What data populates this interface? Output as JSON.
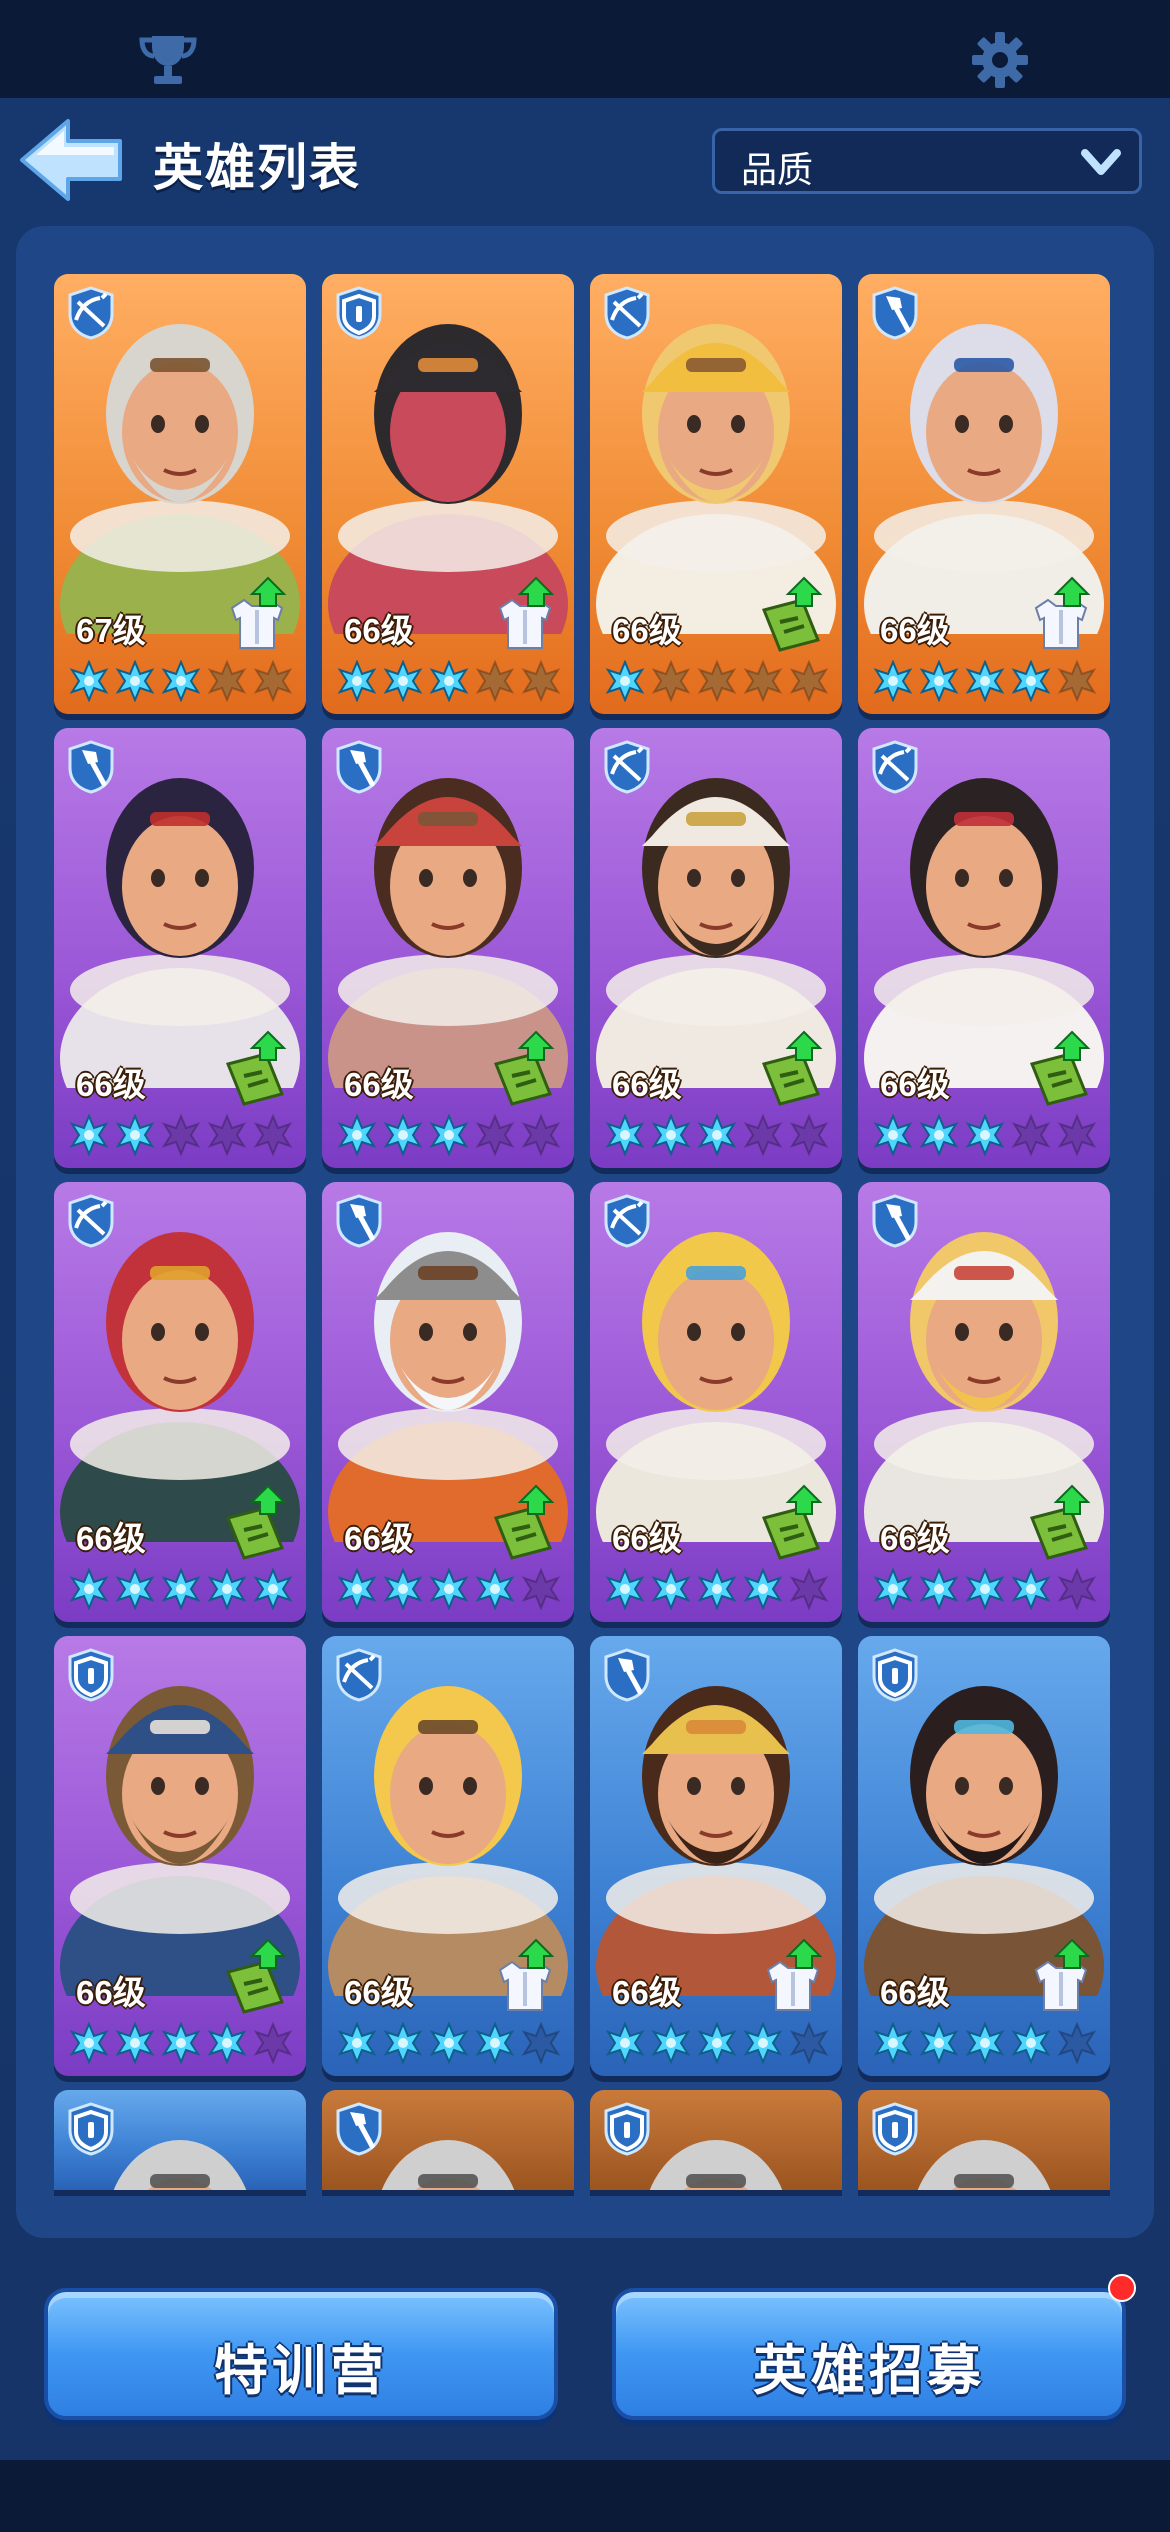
{
  "topbar": {
    "left_icon": "trophy-icon",
    "right_icon": "gear-icon"
  },
  "header": {
    "title": "英雄列表",
    "filter": {
      "selected": "品质"
    }
  },
  "colors": {
    "star_filled": "#4fd6ff",
    "star_empty": "#8f5a2a",
    "accent": "#3f97f2",
    "notify": "#ff2a2a"
  },
  "heroes": [
    {
      "level_label": "67级",
      "stars": 3,
      "rarity": "orange",
      "role_icon": "crossbow-icon",
      "upgrade_icon": "armor-upgrade-icon",
      "look": "old-bearded-ranger"
    },
    {
      "level_label": "66级",
      "stars": 3,
      "rarity": "orange",
      "role_icon": "shield-icon",
      "upgrade_icon": "armor-upgrade-icon",
      "look": "helmet-welder"
    },
    {
      "level_label": "66级",
      "stars": 1,
      "rarity": "orange",
      "role_icon": "crossbow-icon",
      "upgrade_icon": "manual-upgrade-icon",
      "look": "miner-helmet"
    },
    {
      "level_label": "66级",
      "stars": 4,
      "rarity": "orange",
      "role_icon": "shovel-icon",
      "upgrade_icon": "armor-upgrade-icon",
      "look": "goggles-girl"
    },
    {
      "level_label": "66级",
      "stars": 2,
      "rarity": "purple",
      "role_icon": "shovel-icon",
      "upgrade_icon": "manual-upgrade-icon",
      "look": "ponytail-warrior"
    },
    {
      "level_label": "66级",
      "stars": 3,
      "rarity": "purple",
      "role_icon": "shovel-icon",
      "upgrade_icon": "manual-upgrade-icon",
      "look": "headband-man"
    },
    {
      "level_label": "66级",
      "stars": 3,
      "rarity": "purple",
      "role_icon": "crossbow-icon",
      "upgrade_icon": "manual-upgrade-icon",
      "look": "desert-hood"
    },
    {
      "level_label": "66级",
      "stars": 3,
      "rarity": "purple",
      "role_icon": "crossbow-icon",
      "upgrade_icon": "manual-upgrade-icon",
      "look": "nurse-girl"
    },
    {
      "level_label": "66级",
      "stars": 5,
      "rarity": "purple",
      "role_icon": "crossbow-icon",
      "upgrade_icon": "manual-upgrade-icon",
      "look": "red-hair-woman"
    },
    {
      "level_label": "66级",
      "stars": 4,
      "rarity": "purple",
      "role_icon": "shovel-icon",
      "upgrade_icon": "manual-upgrade-icon",
      "look": "viking-dwarf"
    },
    {
      "level_label": "66级",
      "stars": 4,
      "rarity": "purple",
      "role_icon": "crossbow-icon",
      "upgrade_icon": "manual-upgrade-icon",
      "look": "blonde-goggles"
    },
    {
      "level_label": "66级",
      "stars": 4,
      "rarity": "purple",
      "role_icon": "shovel-icon",
      "upgrade_icon": "manual-upgrade-icon",
      "look": "chef"
    },
    {
      "level_label": "66级",
      "stars": 4,
      "rarity": "purple",
      "role_icon": "shield-icon",
      "upgrade_icon": "manual-upgrade-icon",
      "look": "bobby-hat"
    },
    {
      "level_label": "66级",
      "stars": 4,
      "rarity": "blue",
      "role_icon": "crossbow-icon",
      "upgrade_icon": "armor-upgrade-icon",
      "look": "blonde-long-hair"
    },
    {
      "level_label": "66级",
      "stars": 4,
      "rarity": "blue",
      "role_icon": "shovel-icon",
      "upgrade_icon": "armor-upgrade-icon",
      "look": "cap-mustache"
    },
    {
      "level_label": "66级",
      "stars": 4,
      "rarity": "blue",
      "role_icon": "shield-icon",
      "upgrade_icon": "armor-upgrade-icon",
      "look": "goggles-beard"
    },
    {
      "rarity": "blue",
      "role_icon": "shield-icon",
      "look": "partial"
    },
    {
      "rarity": "brown",
      "role_icon": "shovel-icon",
      "look": "partial"
    },
    {
      "rarity": "brown",
      "role_icon": "shield-icon",
      "look": "partial"
    },
    {
      "rarity": "brown",
      "role_icon": "shield-icon",
      "look": "partial"
    }
  ],
  "buttons": {
    "training_label": "特训营",
    "recruit_label": "英雄招募"
  }
}
